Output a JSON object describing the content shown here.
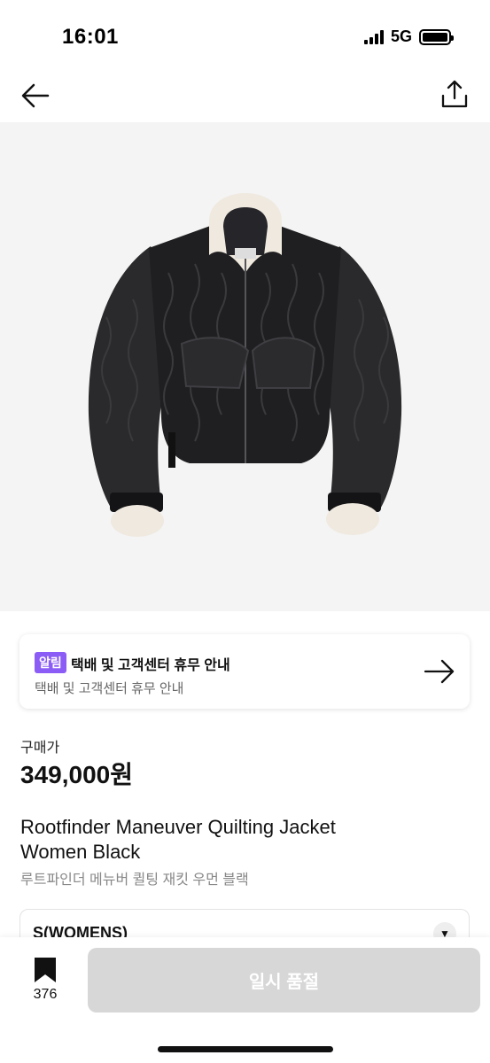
{
  "status": {
    "time": "16:01",
    "network": "5G"
  },
  "notice": {
    "badge": "알림",
    "title": "택배 및 고객센터 휴무 안내",
    "subtitle": "택배 및 고객센터 휴무 안내"
  },
  "price": {
    "label": "구매가",
    "value": "349,000원"
  },
  "product": {
    "name_en": "Rootfinder Maneuver Quilting Jacket Women Black",
    "name_kr": "루트파인더 메뉴버 퀼팅 재킷 우먼 블랙"
  },
  "size": {
    "selected": "S(WOMENS)"
  },
  "bottom": {
    "bookmark_count": "376",
    "action_label": "일시 품절"
  },
  "colors": {
    "badge": "#8b5cf6",
    "button_disabled": "#d7d7d7",
    "image_bg": "#f4f4f4"
  }
}
